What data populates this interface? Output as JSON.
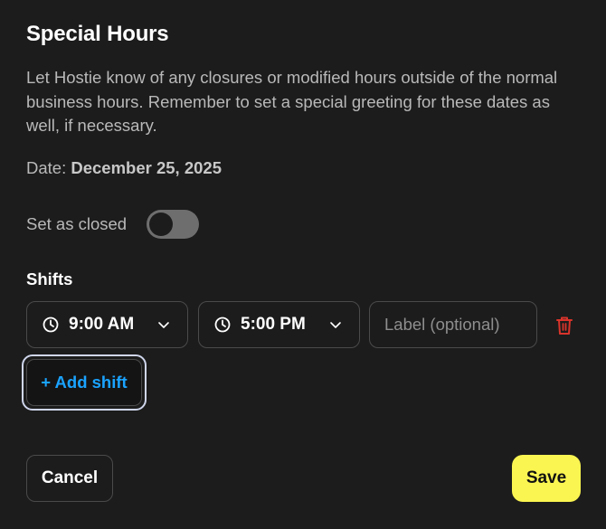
{
  "dialog": {
    "title": "Special Hours",
    "description": "Let Hostie know of any closures or modified hours outside of the normal business hours. Remember to set a special greeting for these dates as well, if necessary.",
    "date_label": "Date: ",
    "date_value": "December 25, 2025",
    "closed_label": "Set as closed",
    "closed_toggle_on": false
  },
  "shifts": {
    "heading": "Shifts",
    "items": [
      {
        "start_time": "9:00 AM",
        "end_time": "5:00 PM",
        "label_value": "",
        "label_placeholder": "Label (optional)"
      }
    ],
    "add_label": "+ Add shift"
  },
  "footer": {
    "cancel_label": "Cancel",
    "save_label": "Save"
  },
  "icons": {
    "clock": "clock-icon",
    "chevron": "chevron-down-icon",
    "delete": "trash-icon"
  },
  "colors": {
    "background": "#1c1c1c",
    "accent_blue": "#1aa3ff",
    "save_yellow": "#fbf551",
    "delete_red": "#d9342b",
    "toggle_off": "#6e6e6e"
  }
}
